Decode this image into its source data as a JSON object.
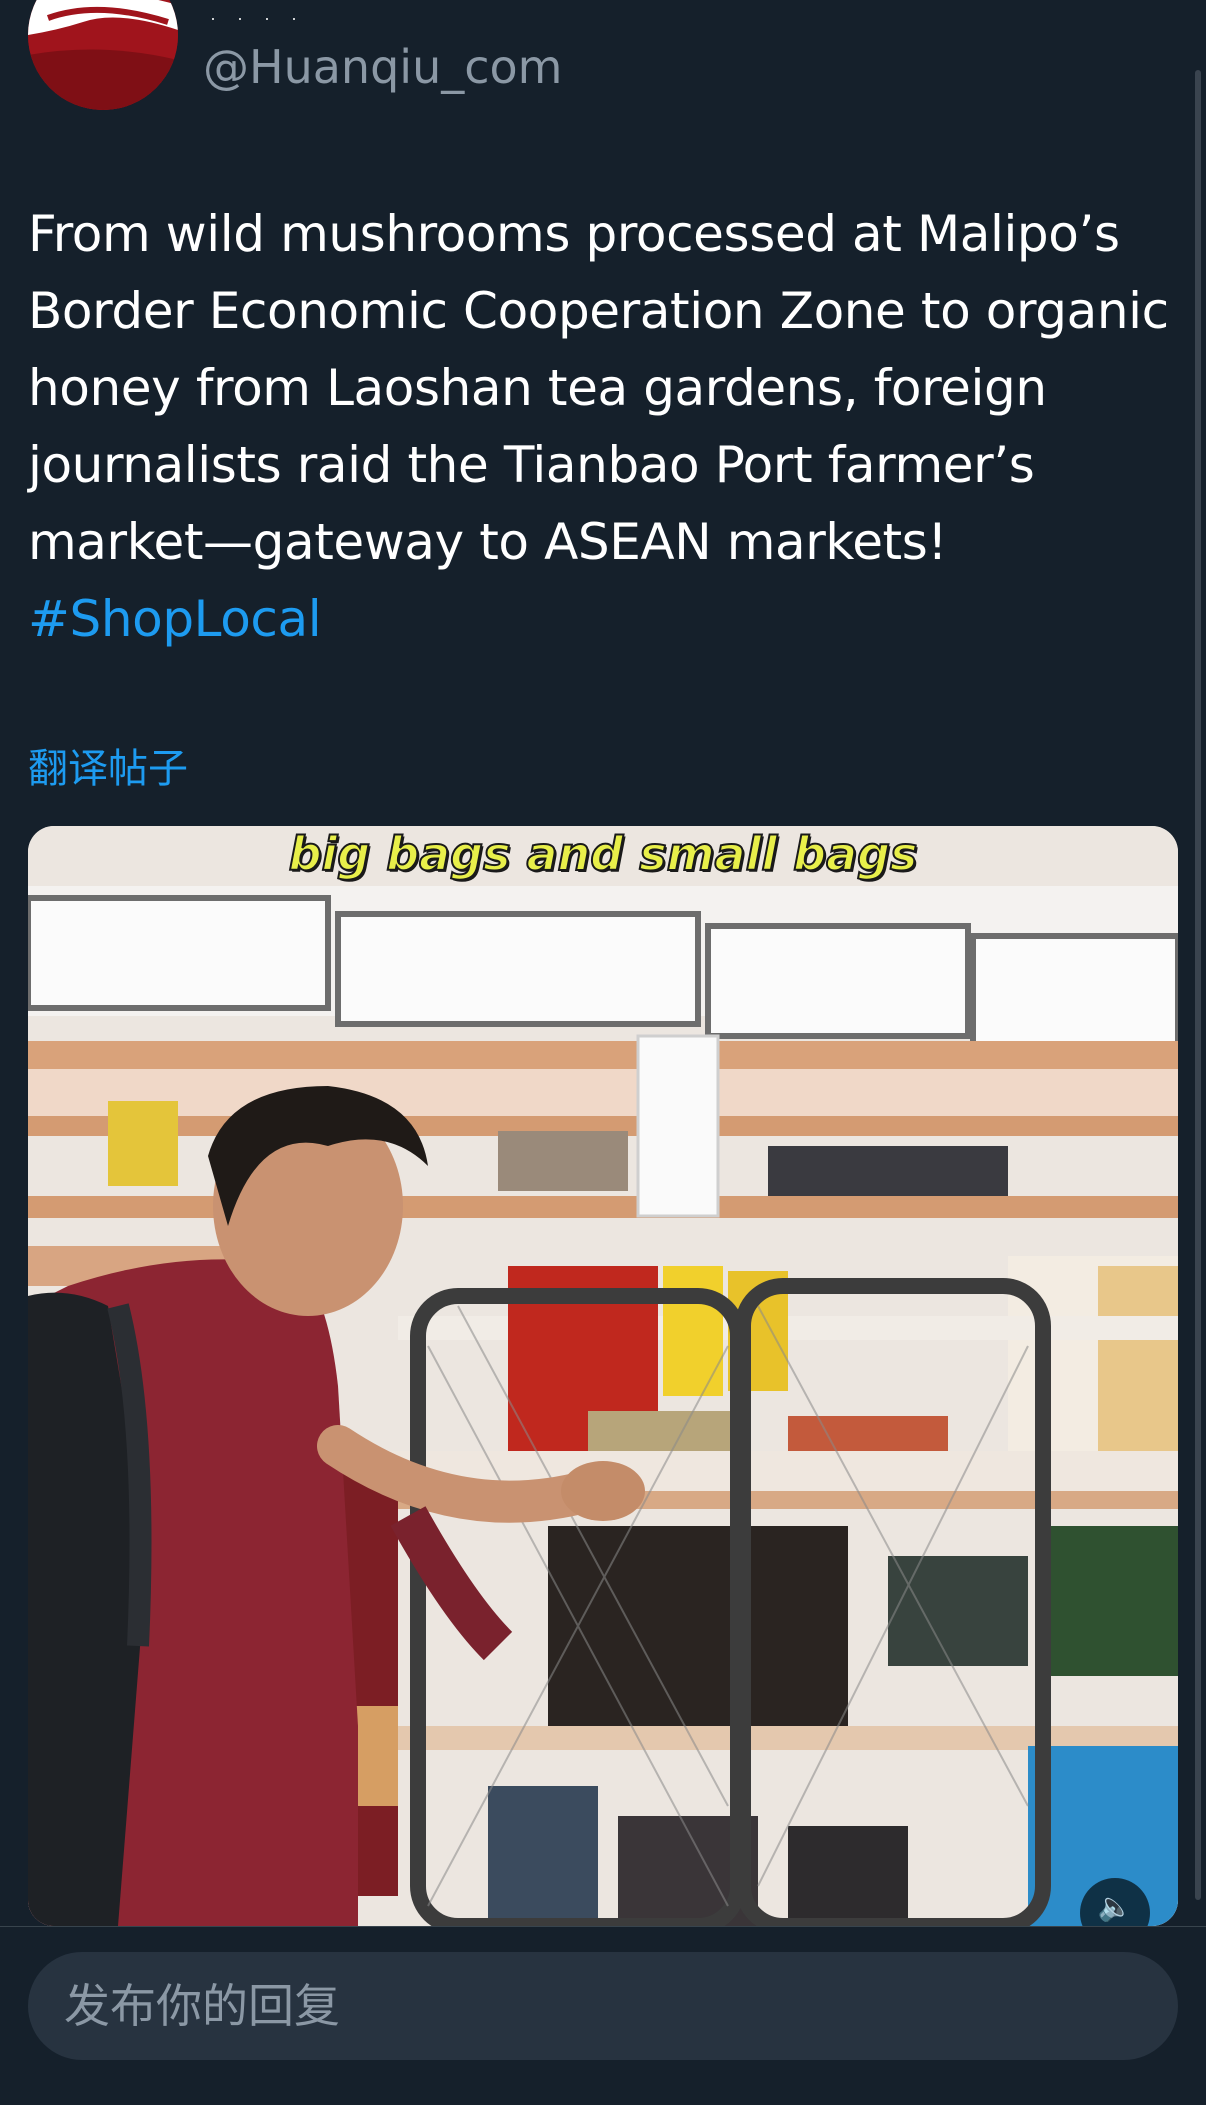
{
  "author": {
    "handle": "@Huanqiu_com",
    "name_fragment": "· · · ·"
  },
  "tweet": {
    "text": "From wild mushrooms processed at Malipo’s Border Economic Cooperation Zone to organic honey from Laoshan tea gardens, foreign journalists raid the Tianbao Port farmer’s market—gateway to ASEAN markets! ",
    "hashtag": "#ShopLocal",
    "translate_label": "翻译帖子"
  },
  "media": {
    "caption": "big bags and small bags",
    "mute_icon": "speaker-muted-icon"
  },
  "reply": {
    "placeholder": "发布你的回复"
  },
  "colors": {
    "background": "#15202b",
    "link": "#1d9bf0",
    "text": "#ffffff",
    "muted": "#8b98a5",
    "input_bg": "#273340",
    "avatar": "#a0141c"
  }
}
